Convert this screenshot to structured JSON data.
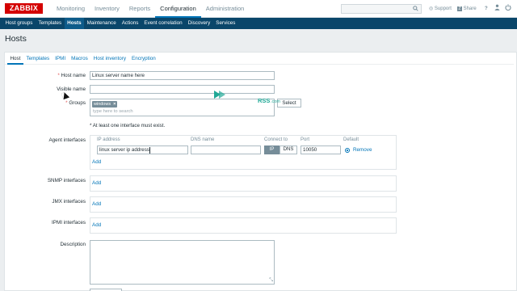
{
  "app": {
    "logo": "ZABBIX",
    "main_menu": [
      "Monitoring",
      "Inventory",
      "Reports",
      "Configuration",
      "Administration"
    ],
    "main_menu_active": "Configuration",
    "search_icon": "search-icon",
    "support_label": "Support",
    "share_label": "Share",
    "help_label": "?",
    "user_icon": "user-icon",
    "signout_icon": "power-icon"
  },
  "submenu": [
    "Host groups",
    "Templates",
    "Hosts",
    "Maintenance",
    "Actions",
    "Event correlation",
    "Discovery",
    "Services"
  ],
  "submenu_active": "Hosts",
  "page": {
    "title": "Hosts"
  },
  "tabs": [
    "Host",
    "Templates",
    "IPMI",
    "Macros",
    "Host inventory",
    "Encryption"
  ],
  "tabs_active": "Host",
  "form": {
    "required_mark": "*",
    "host_name_label": "Host name",
    "host_name_value": "Linux server name here",
    "visible_name_label": "Visible name",
    "visible_name_value": "",
    "groups_label": "Groups",
    "groups_selected": "windows",
    "chip_remove": "×",
    "groups_placeholder": "type here to search",
    "select_button": "Select",
    "interface_hint": "* At least one interface must exist.",
    "agent_label": "Agent interfaces",
    "col_ip": "IP address",
    "col_dns": "DNS name",
    "col_connect": "Connect to",
    "col_port": "Port",
    "col_default": "Default",
    "agent_ip_value": "linux server ip address",
    "agent_dns_value": "",
    "connect_ip": "IP",
    "connect_dns": "DNS",
    "agent_port_value": "10050",
    "remove_label": "Remove",
    "add_label": "Add",
    "snmp_label": "SNMP interfaces",
    "jmx_label": "JMX interfaces",
    "ipmi_label": "IPMI interfaces",
    "description_label": "Description",
    "resize_grip": "⤡"
  },
  "watermark": {
    "text": "RSS",
    "suffix": ".com"
  },
  "colors": {
    "brand_red": "#d40000",
    "header_navy": "#0a466a",
    "link_blue": "#0275b8",
    "required_red": "#e45959",
    "connect_active": "#768d99",
    "watermark_green": "#1fa896"
  }
}
